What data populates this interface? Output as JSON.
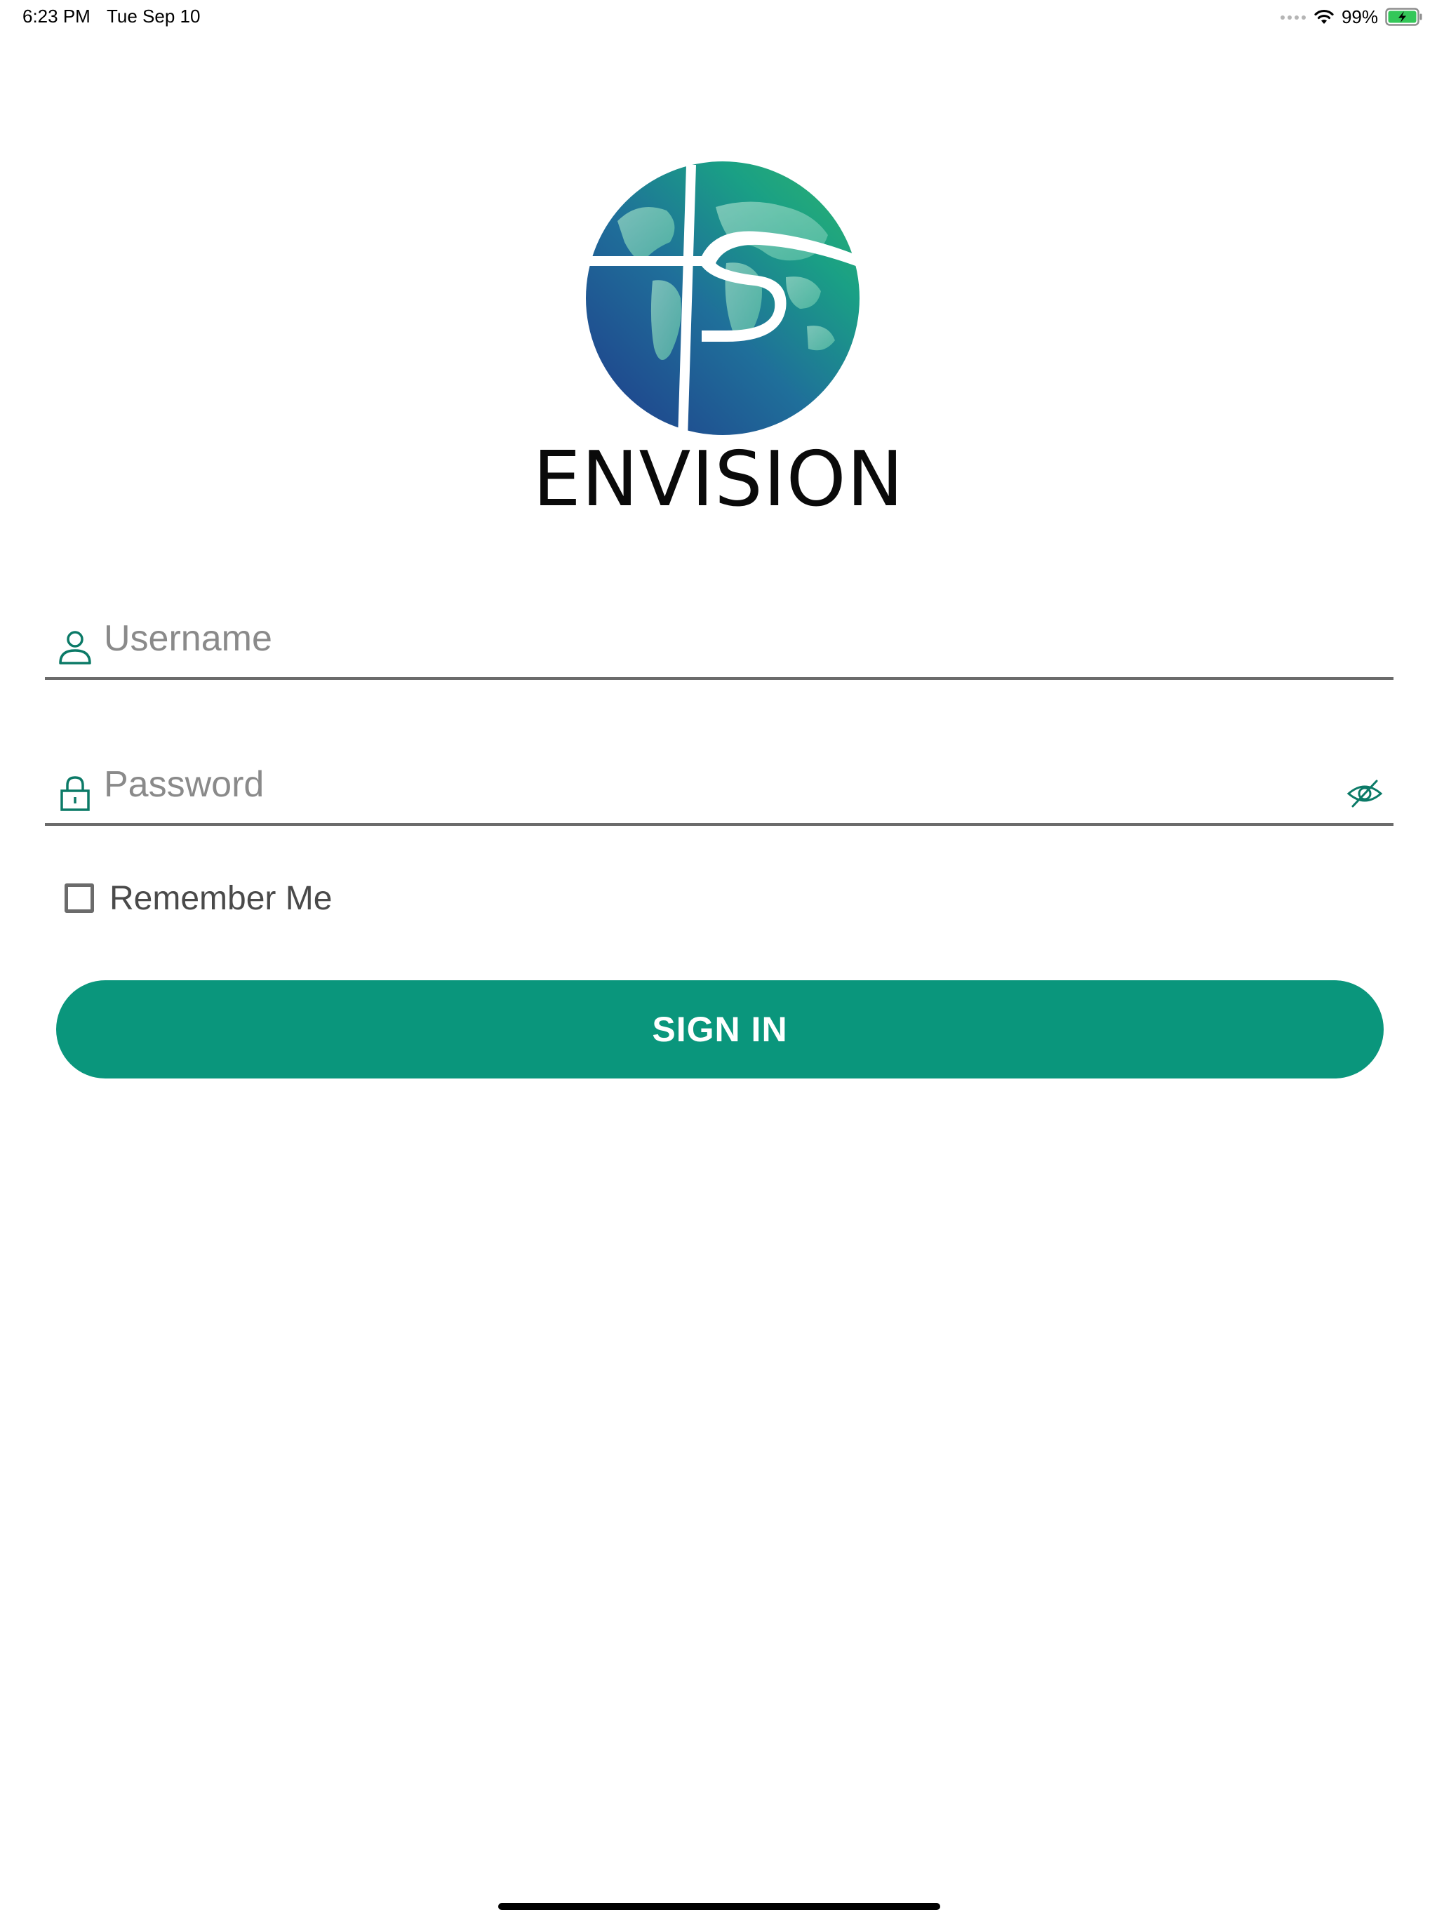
{
  "status_bar": {
    "time": "6:23 PM",
    "date": "Tue Sep 10",
    "battery_percent": "99%",
    "battery_level": 0.99,
    "battery_color": "#34c759",
    "icons": [
      "signal-dots-icon",
      "wifi-icon",
      "battery-charging-icon"
    ]
  },
  "brand": {
    "name": "ENVISION",
    "logo": "globe-logo",
    "accent_color": "#0a967c"
  },
  "login_form": {
    "username": {
      "placeholder": "Username",
      "value": "",
      "icon": "user-icon"
    },
    "password": {
      "placeholder": "Password",
      "value": "",
      "icon": "lock-icon",
      "visibility_icon": "eye-off-icon"
    },
    "remember_me": {
      "label": "Remember Me",
      "checked": false
    },
    "submit_label": "SIGN IN"
  }
}
